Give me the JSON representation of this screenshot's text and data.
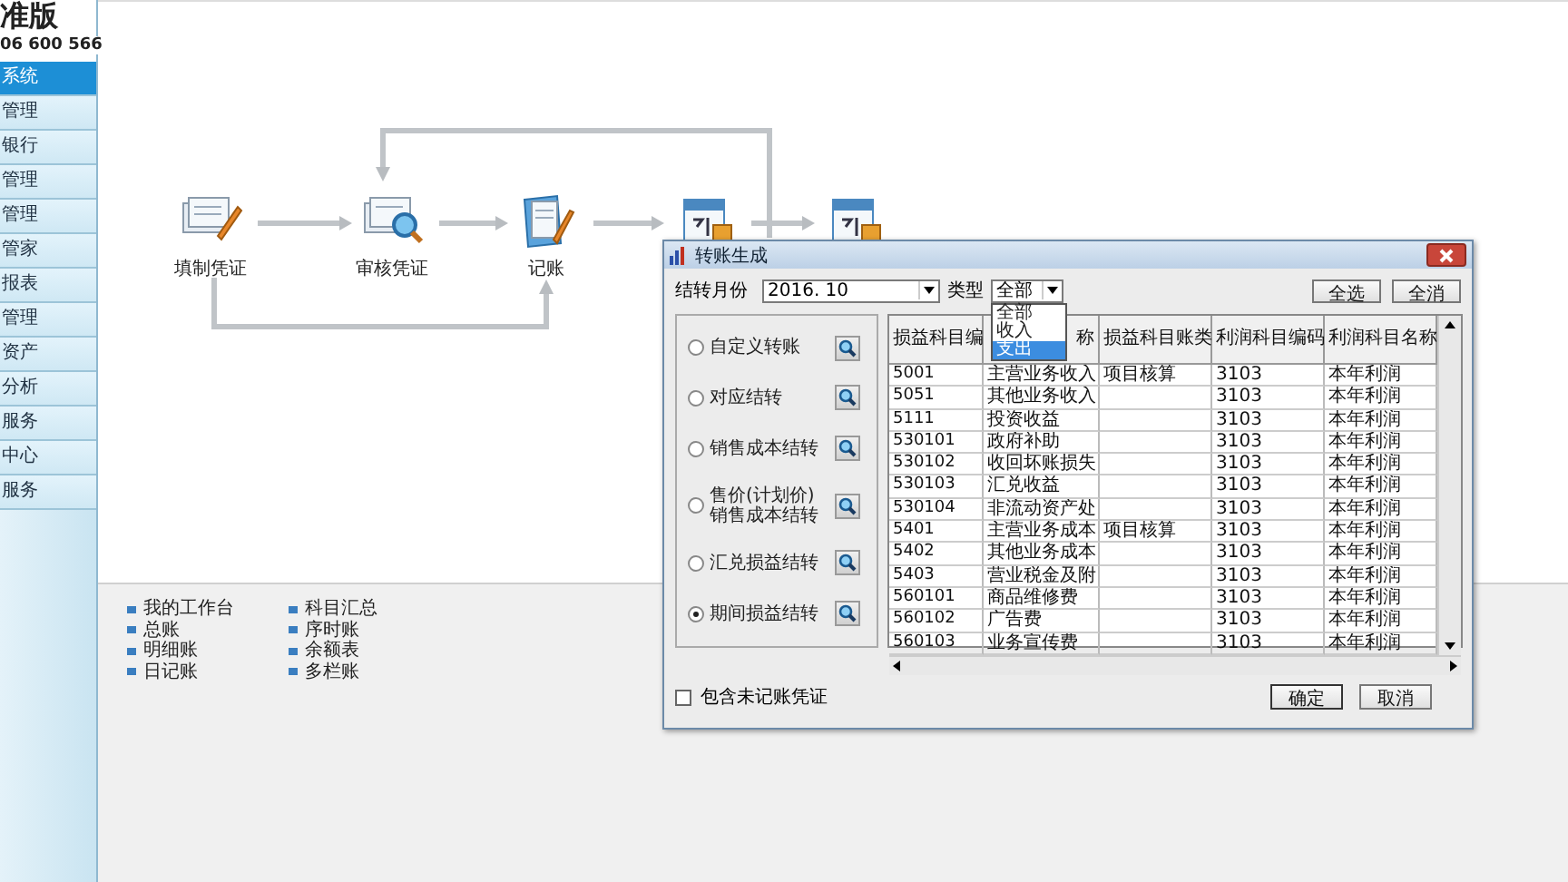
{
  "sidebar": {
    "brand": "准版",
    "phone": "06 600 566",
    "items": [
      {
        "label": "系统",
        "selected": true
      },
      {
        "label": "管理",
        "selected": false
      },
      {
        "label": "银行",
        "selected": false
      },
      {
        "label": "管理",
        "selected": false
      },
      {
        "label": "管理",
        "selected": false
      },
      {
        "label": "管家",
        "selected": false
      },
      {
        "label": "报表",
        "selected": false
      },
      {
        "label": "管理",
        "selected": false
      },
      {
        "label": "资产",
        "selected": false
      },
      {
        "label": "分析",
        "selected": false
      },
      {
        "label": "服务",
        "selected": false
      },
      {
        "label": "中心",
        "selected": false
      },
      {
        "label": "服务",
        "selected": false
      }
    ]
  },
  "flow": {
    "nodes": [
      {
        "kind": "edit",
        "label": "填制凭证"
      },
      {
        "kind": "review",
        "label": "审核凭证"
      },
      {
        "kind": "post",
        "label": "记账"
      },
      {
        "kind": "calendar"
      },
      {
        "kind": "calendar"
      }
    ]
  },
  "quick_links": {
    "columns": [
      [
        "我的工作台",
        "总账",
        "明细账",
        "日记账"
      ],
      [
        "科目汇总",
        "序时账",
        "余额表",
        "多栏账"
      ]
    ]
  },
  "dialog": {
    "title": "转账生成",
    "month_label": "结转月份",
    "month_value": "2016. 10",
    "type_label": "类型",
    "type_value": "全部",
    "type_dropdown": {
      "options": [
        {
          "label": "全部",
          "selected": false
        },
        {
          "label": "收入",
          "selected": false
        },
        {
          "label": "支出",
          "selected": true
        }
      ]
    },
    "top_buttons": [
      "全选",
      "全消"
    ],
    "options": [
      {
        "label": "自定义转账",
        "selected": false
      },
      {
        "label": "对应结转",
        "selected": false
      },
      {
        "label": "销售成本结转",
        "selected": false
      },
      {
        "label": "售价(计划价)销售成本结转",
        "selected": false
      },
      {
        "label": "汇兑损益结转",
        "selected": false
      },
      {
        "label": "期间损益结转",
        "selected": true
      }
    ],
    "table": {
      "columns": [
        "损益科目编",
        "称",
        "损益科目账类",
        "利润科目编码",
        "利润科目名称"
      ],
      "rows": [
        [
          "5001",
          "主营业务收入",
          "项目核算",
          "3103",
          "本年利润"
        ],
        [
          "5051",
          "其他业务收入",
          "",
          "3103",
          "本年利润"
        ],
        [
          "5111",
          "投资收益",
          "",
          "3103",
          "本年利润"
        ],
        [
          "530101",
          "政府补助",
          "",
          "3103",
          "本年利润"
        ],
        [
          "530102",
          "收回坏账损失",
          "",
          "3103",
          "本年利润"
        ],
        [
          "530103",
          "汇兑收益",
          "",
          "3103",
          "本年利润"
        ],
        [
          "530104",
          "非流动资产处",
          "",
          "3103",
          "本年利润"
        ],
        [
          "5401",
          "主营业务成本",
          "项目核算",
          "3103",
          "本年利润"
        ],
        [
          "5402",
          "其他业务成本",
          "",
          "3103",
          "本年利润"
        ],
        [
          "5403",
          "营业税金及附",
          "",
          "3103",
          "本年利润"
        ],
        [
          "560101",
          "商品维修费",
          "",
          "3103",
          "本年利润"
        ],
        [
          "560102",
          "广告费",
          "",
          "3103",
          "本年利润"
        ],
        [
          "560103",
          "业务宣传费",
          "",
          "3103",
          "本年利润"
        ]
      ]
    },
    "include_unposted": {
      "label": "包含未记账凭证",
      "checked": false
    },
    "buttons": [
      "确定",
      "取消"
    ]
  }
}
